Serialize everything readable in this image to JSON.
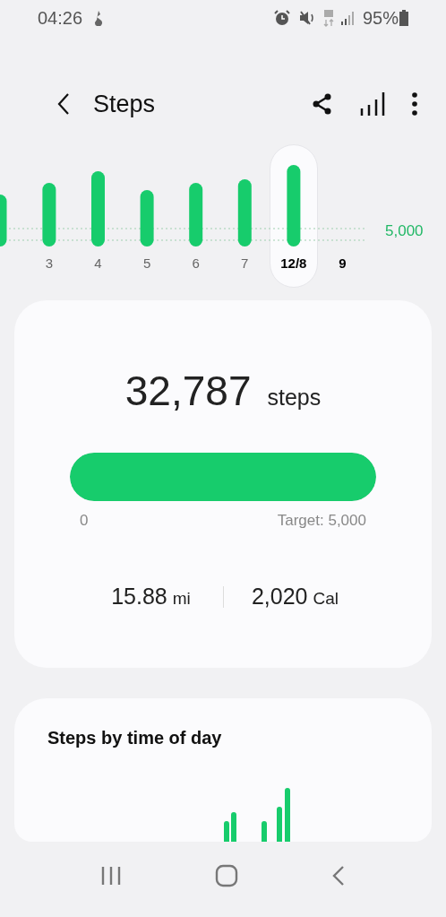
{
  "status_bar": {
    "time": "04:26",
    "battery": "95%"
  },
  "header": {
    "title": "Steps"
  },
  "day_strip": {
    "target_label": "5,000",
    "days": [
      {
        "label": "3",
        "selected": false,
        "emphasized": false
      },
      {
        "label": "4",
        "selected": false,
        "emphasized": false
      },
      {
        "label": "5",
        "selected": false,
        "emphasized": false
      },
      {
        "label": "6",
        "selected": false,
        "emphasized": false
      },
      {
        "label": "7",
        "selected": false,
        "emphasized": false
      },
      {
        "label": "12/8",
        "selected": true,
        "emphasized": true
      },
      {
        "label": "9",
        "selected": false,
        "emphasized": true
      }
    ]
  },
  "summary": {
    "count": "32,787",
    "unit": "steps",
    "progress": {
      "level": 1.0,
      "start": "0",
      "target": "Target: 5,000"
    },
    "stats": [
      {
        "value": "15.88",
        "unit": "mi"
      },
      {
        "value": "2,020",
        "unit": "Cal"
      }
    ]
  },
  "time_of_day": {
    "title": "Steps by time of day"
  }
}
